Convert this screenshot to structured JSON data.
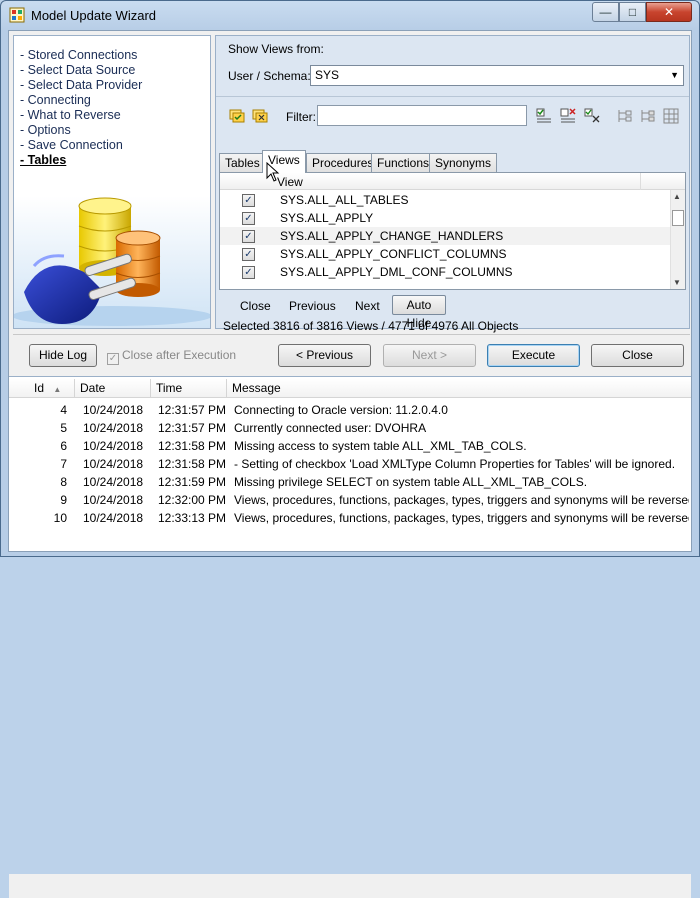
{
  "window": {
    "title": "Model Update Wizard",
    "controls": {
      "minimize": "—",
      "maximize": "□",
      "close": "✕"
    }
  },
  "nav": {
    "items": [
      {
        "label": "- Stored Connections",
        "current": false
      },
      {
        "label": "- Select Data Source",
        "current": false
      },
      {
        "label": "- Select Data Provider",
        "current": false
      },
      {
        "label": "- Connecting",
        "current": false
      },
      {
        "label": "- What to Reverse",
        "current": false
      },
      {
        "label": "- Options",
        "current": false
      },
      {
        "label": "- Save Connection",
        "current": false
      },
      {
        "label": "- Tables",
        "current": true
      }
    ]
  },
  "show_views": {
    "heading": "Show Views from:",
    "schema_label": "User / Schema:",
    "schema_value": "SYS"
  },
  "toolbar": {
    "filter_label": "Filter:",
    "filter_value": ""
  },
  "tabs": [
    {
      "label": "Tables",
      "active": false
    },
    {
      "label": "Views",
      "active": true
    },
    {
      "label": "Procedures",
      "active": false
    },
    {
      "label": "Functions",
      "active": false
    },
    {
      "label": "Synonyms",
      "active": false
    }
  ],
  "grid": {
    "column_header": "View",
    "rows": [
      {
        "name": "SYS.ALL_ALL_TABLES",
        "checked": true,
        "selected": false
      },
      {
        "name": "SYS.ALL_APPLY",
        "checked": true,
        "selected": false
      },
      {
        "name": "SYS.ALL_APPLY_CHANGE_HANDLERS",
        "checked": true,
        "selected": true
      },
      {
        "name": "SYS.ALL_APPLY_CONFLICT_COLUMNS",
        "checked": true,
        "selected": false
      },
      {
        "name": "SYS.ALL_APPLY_DML_CONF_COLUMNS",
        "checked": true,
        "selected": false
      }
    ]
  },
  "grid_nav": {
    "close": "Close",
    "previous": "Previous",
    "next": "Next",
    "auto_hide": "Auto Hide"
  },
  "selection_status": "Selected 3816 of 3816 Views / 4771 of 4976 All Objects",
  "buttons": {
    "hide_log": "Hide Log",
    "close_after_execution": "Close after Execution",
    "previous": "< Previous",
    "next": "Next >",
    "execute": "Execute",
    "close": "Close"
  },
  "log": {
    "headers": {
      "id": "Id",
      "date": "Date",
      "time": "Time",
      "message": "Message"
    },
    "rows": [
      {
        "id": "4",
        "date": "10/24/2018",
        "time": "12:31:57 PM",
        "message": "Connecting to Oracle version: 11.2.0.4.0"
      },
      {
        "id": "5",
        "date": "10/24/2018",
        "time": "12:31:57 PM",
        "message": "Currently connected user: DVOHRA"
      },
      {
        "id": "6",
        "date": "10/24/2018",
        "time": "12:31:58 PM",
        "message": "Missing access to system table ALL_XML_TAB_COLS."
      },
      {
        "id": "7",
        "date": "10/24/2018",
        "time": "12:31:58 PM",
        "message": " - Setting of checkbox 'Load XMLType Column Properties for Tables' will be ignored."
      },
      {
        "id": "8",
        "date": "10/24/2018",
        "time": "12:31:59 PM",
        "message": "Missing privilege SELECT on system table ALL_XML_TAB_COLS."
      },
      {
        "id": "9",
        "date": "10/24/2018",
        "time": "12:32:00 PM",
        "message": "Views, procedures, functions, packages, types, triggers and synonyms will be reversed from e..."
      },
      {
        "id": "10",
        "date": "10/24/2018",
        "time": "12:33:13 PM",
        "message": "Views, procedures, functions, packages, types, triggers and synonyms will be reversed from e..."
      }
    ]
  },
  "icons": {
    "app": "model-wizard-icon",
    "toolbar": [
      "check-all-icon",
      "uncheck-all-icon",
      "filter-check-icon",
      "filter-uncheck-icon",
      "filter-invert-icon",
      "tree-expand-icon",
      "tree-collapse-icon",
      "grid-icon"
    ]
  }
}
